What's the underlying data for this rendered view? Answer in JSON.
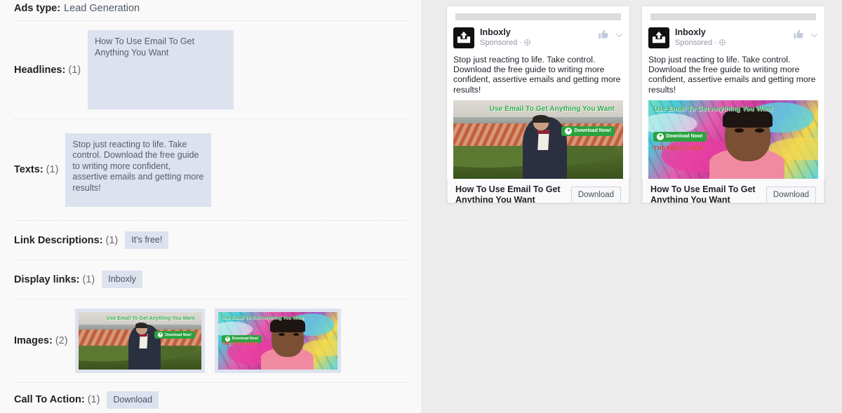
{
  "left": {
    "ads_type": {
      "label": "Ads type:",
      "value": "Lead Generation"
    },
    "rows": [
      {
        "label": "Headlines:",
        "count": "(1)"
      },
      {
        "label": "Texts:",
        "count": "(1)"
      },
      {
        "label": "Link Descriptions:",
        "count": "(1)"
      },
      {
        "label": "Display links:",
        "count": "(1)"
      },
      {
        "label": "Images:",
        "count": "(2)"
      },
      {
        "label": "Call To Action:",
        "count": "(1)"
      }
    ],
    "headline_text": "How To Use Email To Get Anything You Want",
    "body_text": "Stop just reacting to life. Take control. Download the free guide to writing more confident, assertive emails and getting more results!",
    "link_description_tag": "It's free!",
    "display_link_tag": "Inboxly",
    "cta_tag": "Download"
  },
  "creatives": [
    {
      "overlay_headline": "Use Email To Get Anything You Want",
      "overlay_button": "Download Now!",
      "overlay_free": ""
    },
    {
      "overlay_headline": "Use Email To Get Anything You Want",
      "overlay_button": "Download Now!",
      "overlay_free": "THE FREE GUIDE"
    }
  ],
  "preview": {
    "cards": [
      {
        "brand": "Inboxly",
        "sponsored": "Sponsored",
        "body": "Stop just reacting to life. Take control. Download the free guide to writing more confident, assertive emails and getting more results!",
        "footer_title": "How To Use Email To Get Anything You Want",
        "cta": "Download"
      },
      {
        "brand": "Inboxly",
        "sponsored": "Sponsored",
        "body": "Stop just reacting to life. Take control. Download the free guide to writing more confident, assertive emails and getting more results!",
        "footer_title": "How To Use Email To Get Anything You Want",
        "cta": "Download"
      }
    ]
  },
  "colors": {
    "tag_bg": "#dde2ef",
    "tag_text": "#4a5462",
    "left_bg": "#f9f9f9",
    "right_bg": "#ececec",
    "green": "#2aa33f",
    "red": "#d8352b"
  }
}
